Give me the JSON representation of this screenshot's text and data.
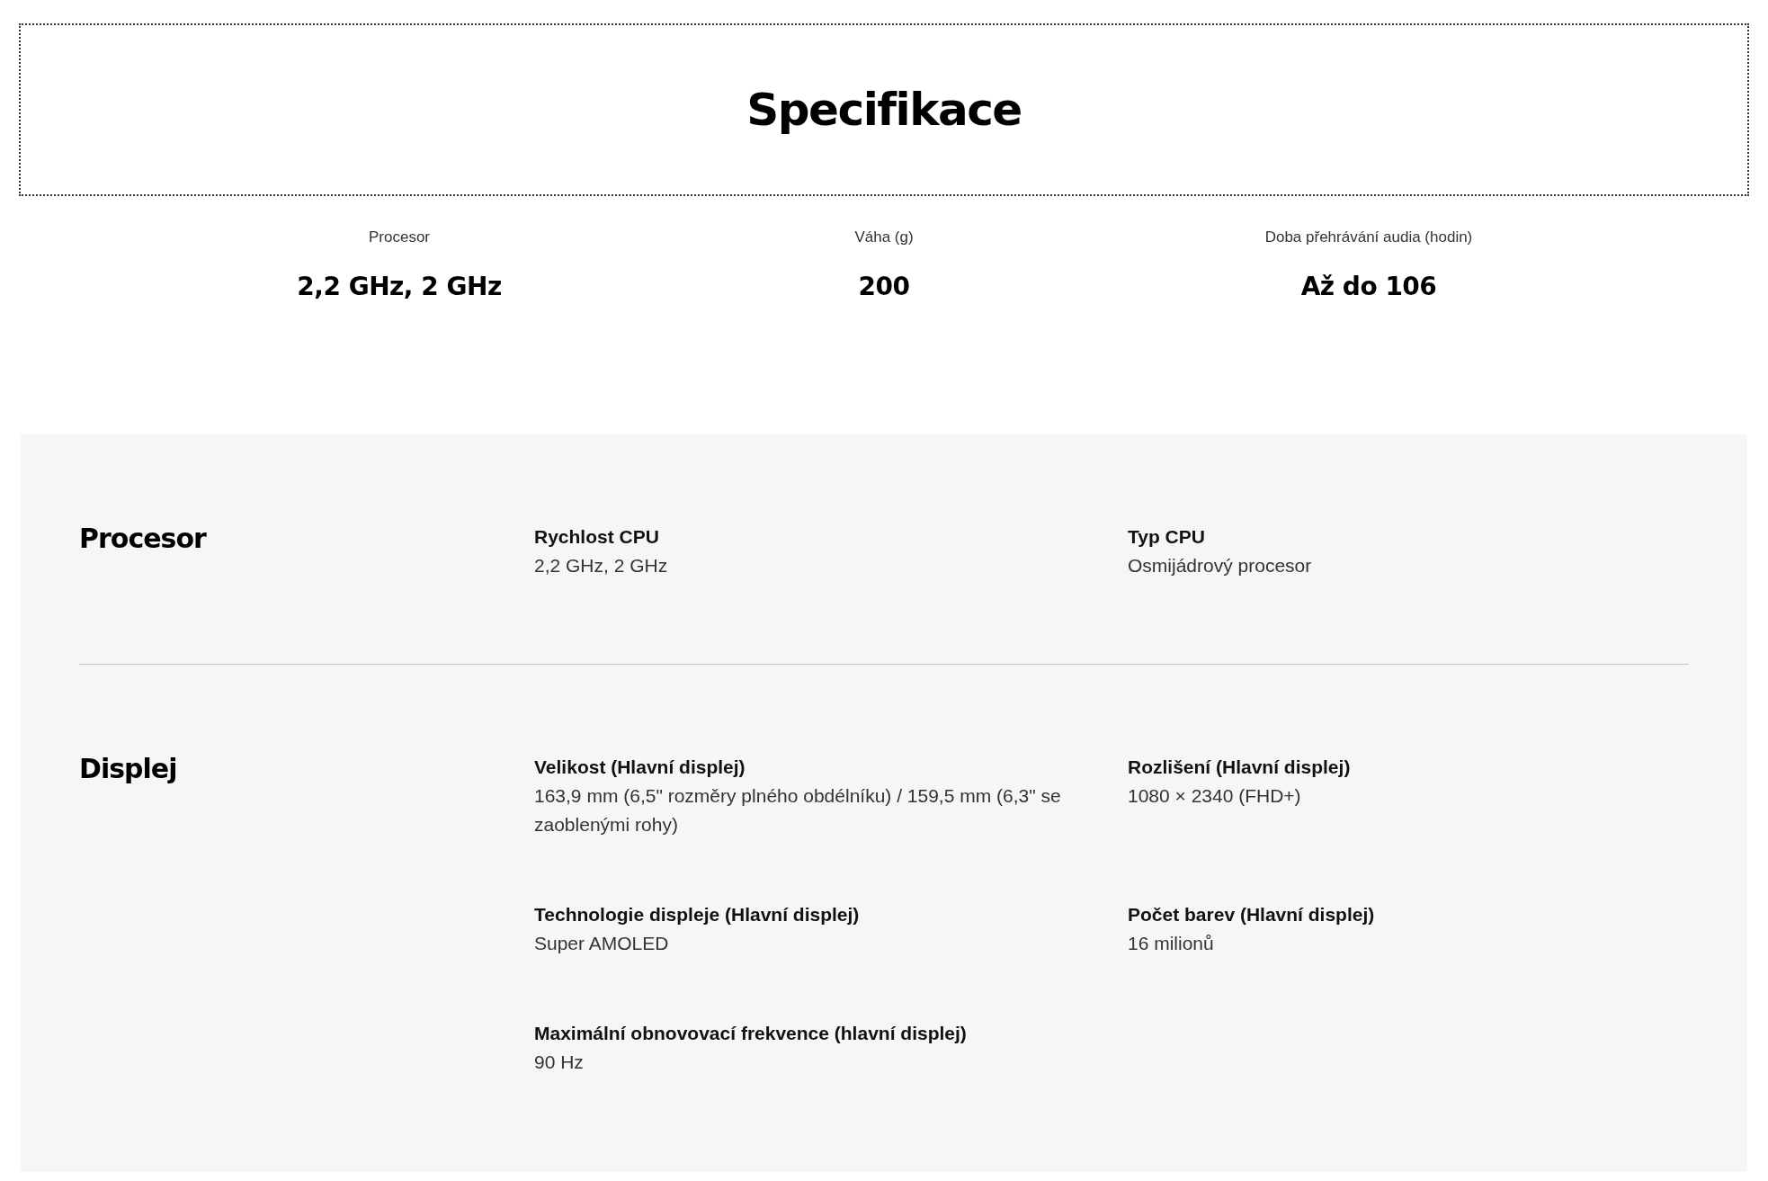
{
  "title": "Specifikace",
  "highlights": [
    {
      "label": "Procesor",
      "value": "2,2 GHz, 2 GHz"
    },
    {
      "label": "Váha (g)",
      "value": "200"
    },
    {
      "label": "Doba přehrávání audia (hodin)",
      "value": "Až do 106"
    }
  ],
  "sections": [
    {
      "title": "Procesor",
      "items": [
        {
          "label": "Rychlost CPU",
          "value": "2,2 GHz, 2 GHz"
        },
        {
          "label": "Typ CPU",
          "value": "Osmijádrový procesor"
        }
      ]
    },
    {
      "title": "Displej",
      "items": [
        {
          "label": "Velikost (Hlavní displej)",
          "value": "163,9 mm (6,5\" rozměry plného obdélníku) / 159,5 mm (6,3\" se zaoblenými rohy)"
        },
        {
          "label": "Rozlišení (Hlavní displej)",
          "value": "1080 × 2340 (FHD+)"
        },
        {
          "label": "Technologie displeje (Hlavní displej)",
          "value": "Super AMOLED"
        },
        {
          "label": "Počet barev (Hlavní displej)",
          "value": "16 milionů"
        },
        {
          "label": "Maximální obnovovací frekvence (hlavní displej)",
          "value": "90 Hz"
        }
      ]
    }
  ]
}
